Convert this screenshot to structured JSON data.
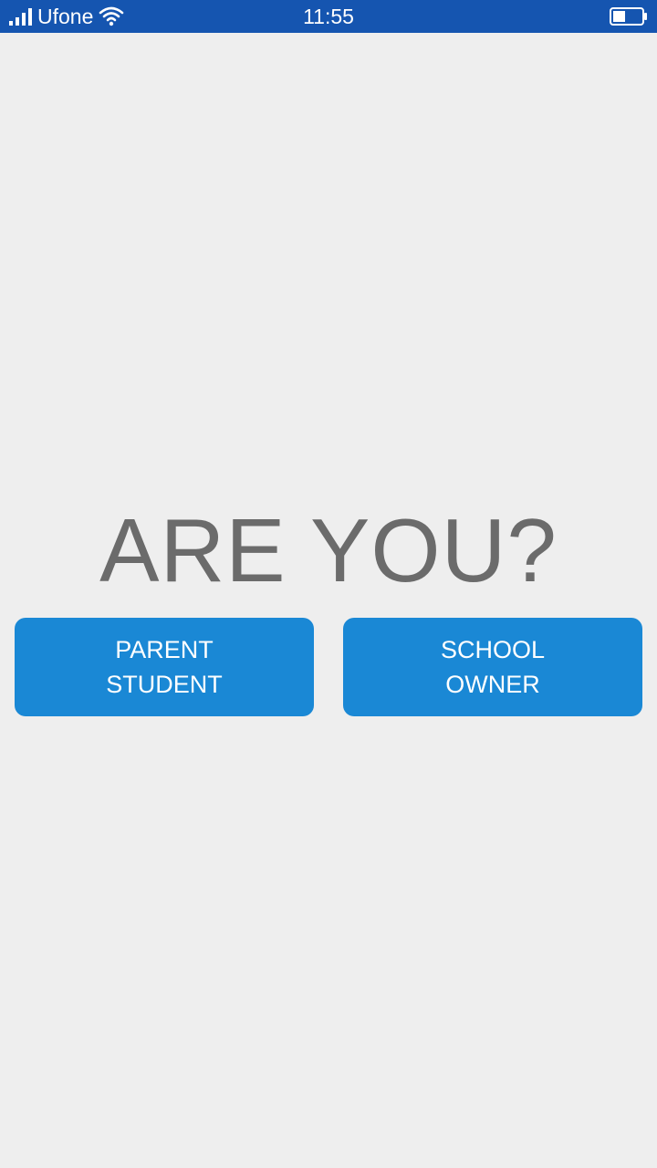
{
  "status_bar": {
    "carrier": "Ufone",
    "time": "11:55",
    "background": "#1555b0"
  },
  "prompt": {
    "title": "ARE YOU?"
  },
  "buttons": [
    {
      "line1": "PARENT",
      "line2": "STUDENT"
    },
    {
      "line1": "SCHOOL",
      "line2": "OWNER"
    }
  ],
  "colors": {
    "accent": "#1a88d5",
    "background": "#eeeeee",
    "title_text": "#6b6b6b"
  },
  "icons": [
    "signal-icon",
    "wifi-icon",
    "battery-icon"
  ]
}
